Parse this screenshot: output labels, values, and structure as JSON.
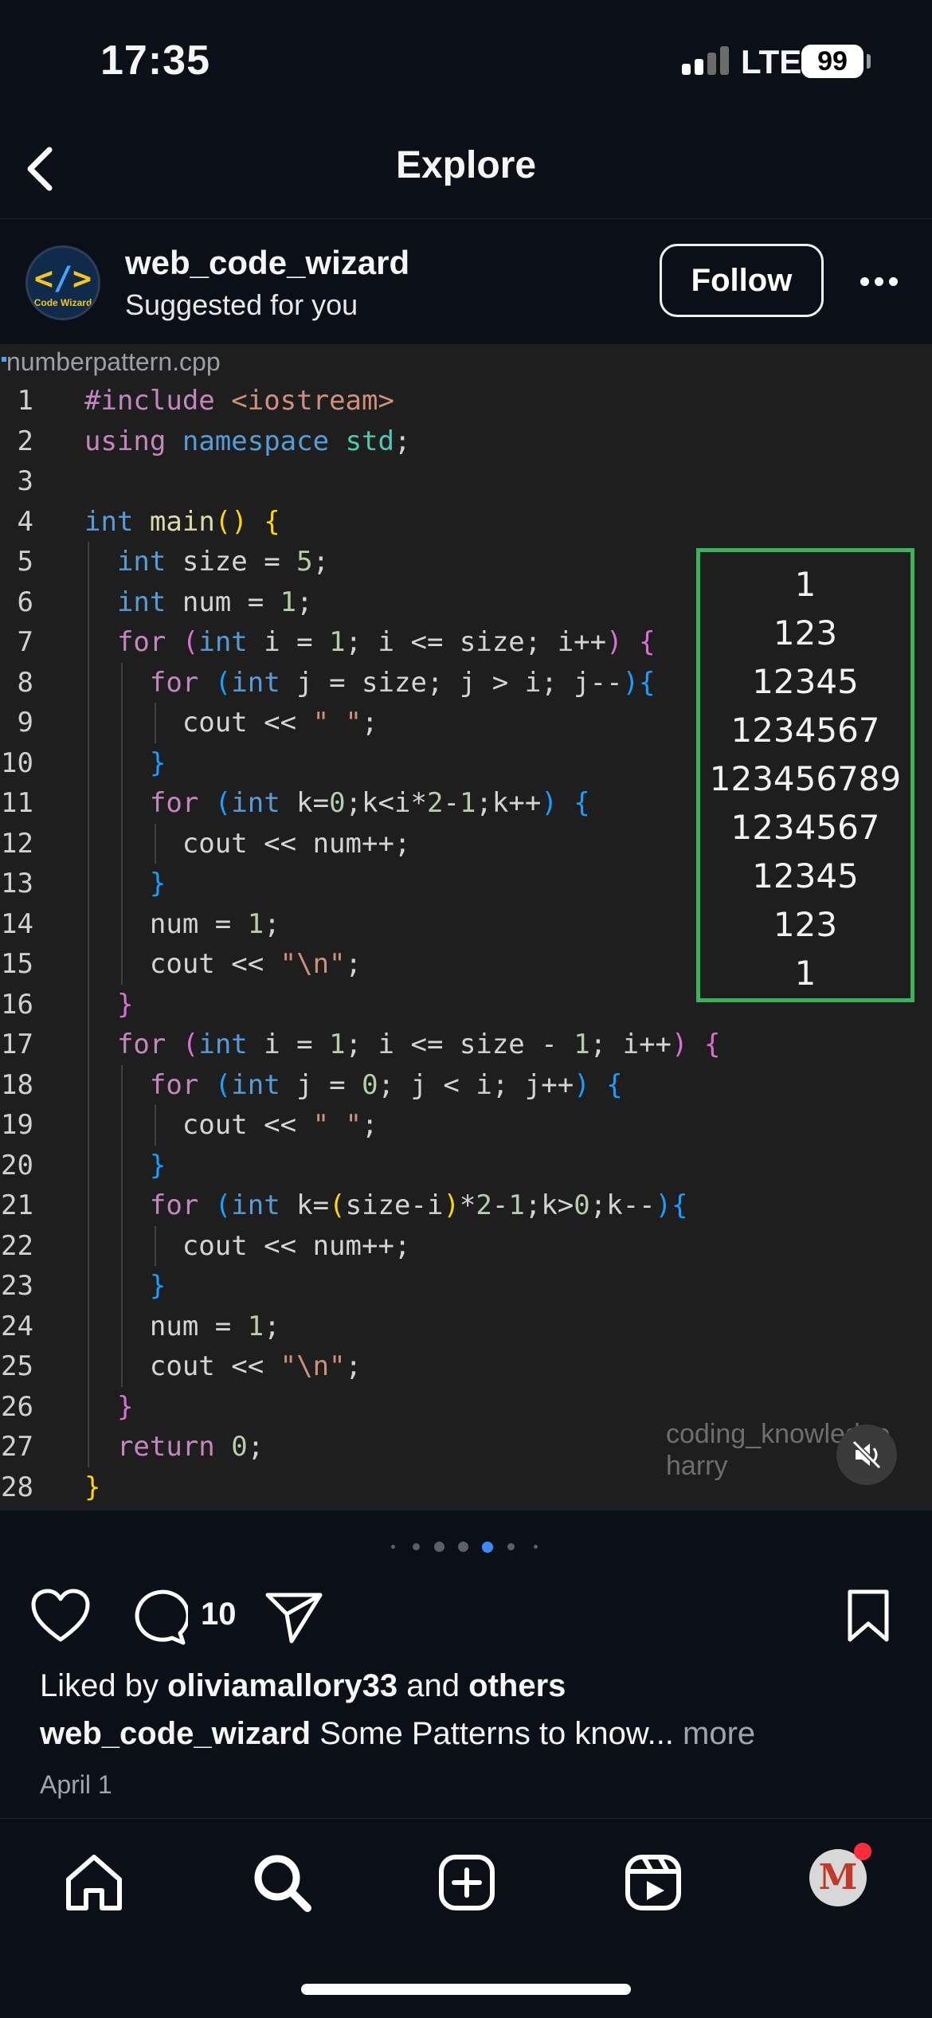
{
  "status_bar": {
    "time": "17:35",
    "network": "LTE",
    "battery": "99"
  },
  "header": {
    "title": "Explore"
  },
  "post": {
    "username": "web_code_wizard",
    "subtitle": "Suggested for you",
    "avatar_label": "Code Wizard",
    "follow_label": "Follow"
  },
  "code_image": {
    "filename": "numberpattern.cpp",
    "line_numbers": [
      "1",
      "2",
      "3",
      "4",
      "5",
      "6",
      "7",
      "8",
      "9",
      "10",
      "11",
      "12",
      "13",
      "14",
      "15",
      "16",
      "17",
      "18",
      "19",
      "20",
      "21",
      "22",
      "23",
      "24",
      "25",
      "26",
      "27",
      "28"
    ],
    "output_rows": [
      "1",
      "123",
      "12345",
      "1234567",
      "123456789",
      "1234567",
      "12345",
      "123",
      "1"
    ],
    "watermark_line1": "coding_knowledge",
    "watermark_line2": "harry",
    "output_box_color": "#3cb35a"
  },
  "carousel": {
    "total": 7,
    "active_index": 3
  },
  "actions": {
    "comment_count": "10"
  },
  "caption": {
    "liked_prefix": "Liked by",
    "liked_user": "oliviamallory33",
    "liked_and": "and",
    "liked_others": "others",
    "author": "web_code_wizard",
    "text": "Some Patterns to know...",
    "more": "more",
    "date": "April 1"
  },
  "tabbar": {
    "items": [
      "home-icon",
      "search-icon",
      "create-icon",
      "reels-icon",
      "profile-avatar"
    ],
    "profile_initial": "M"
  },
  "colors": {
    "background": "#0b0f17",
    "code_bg": "#1e1e1e",
    "active_dot": "#3a8bff",
    "notification": "#ff2d3b"
  }
}
